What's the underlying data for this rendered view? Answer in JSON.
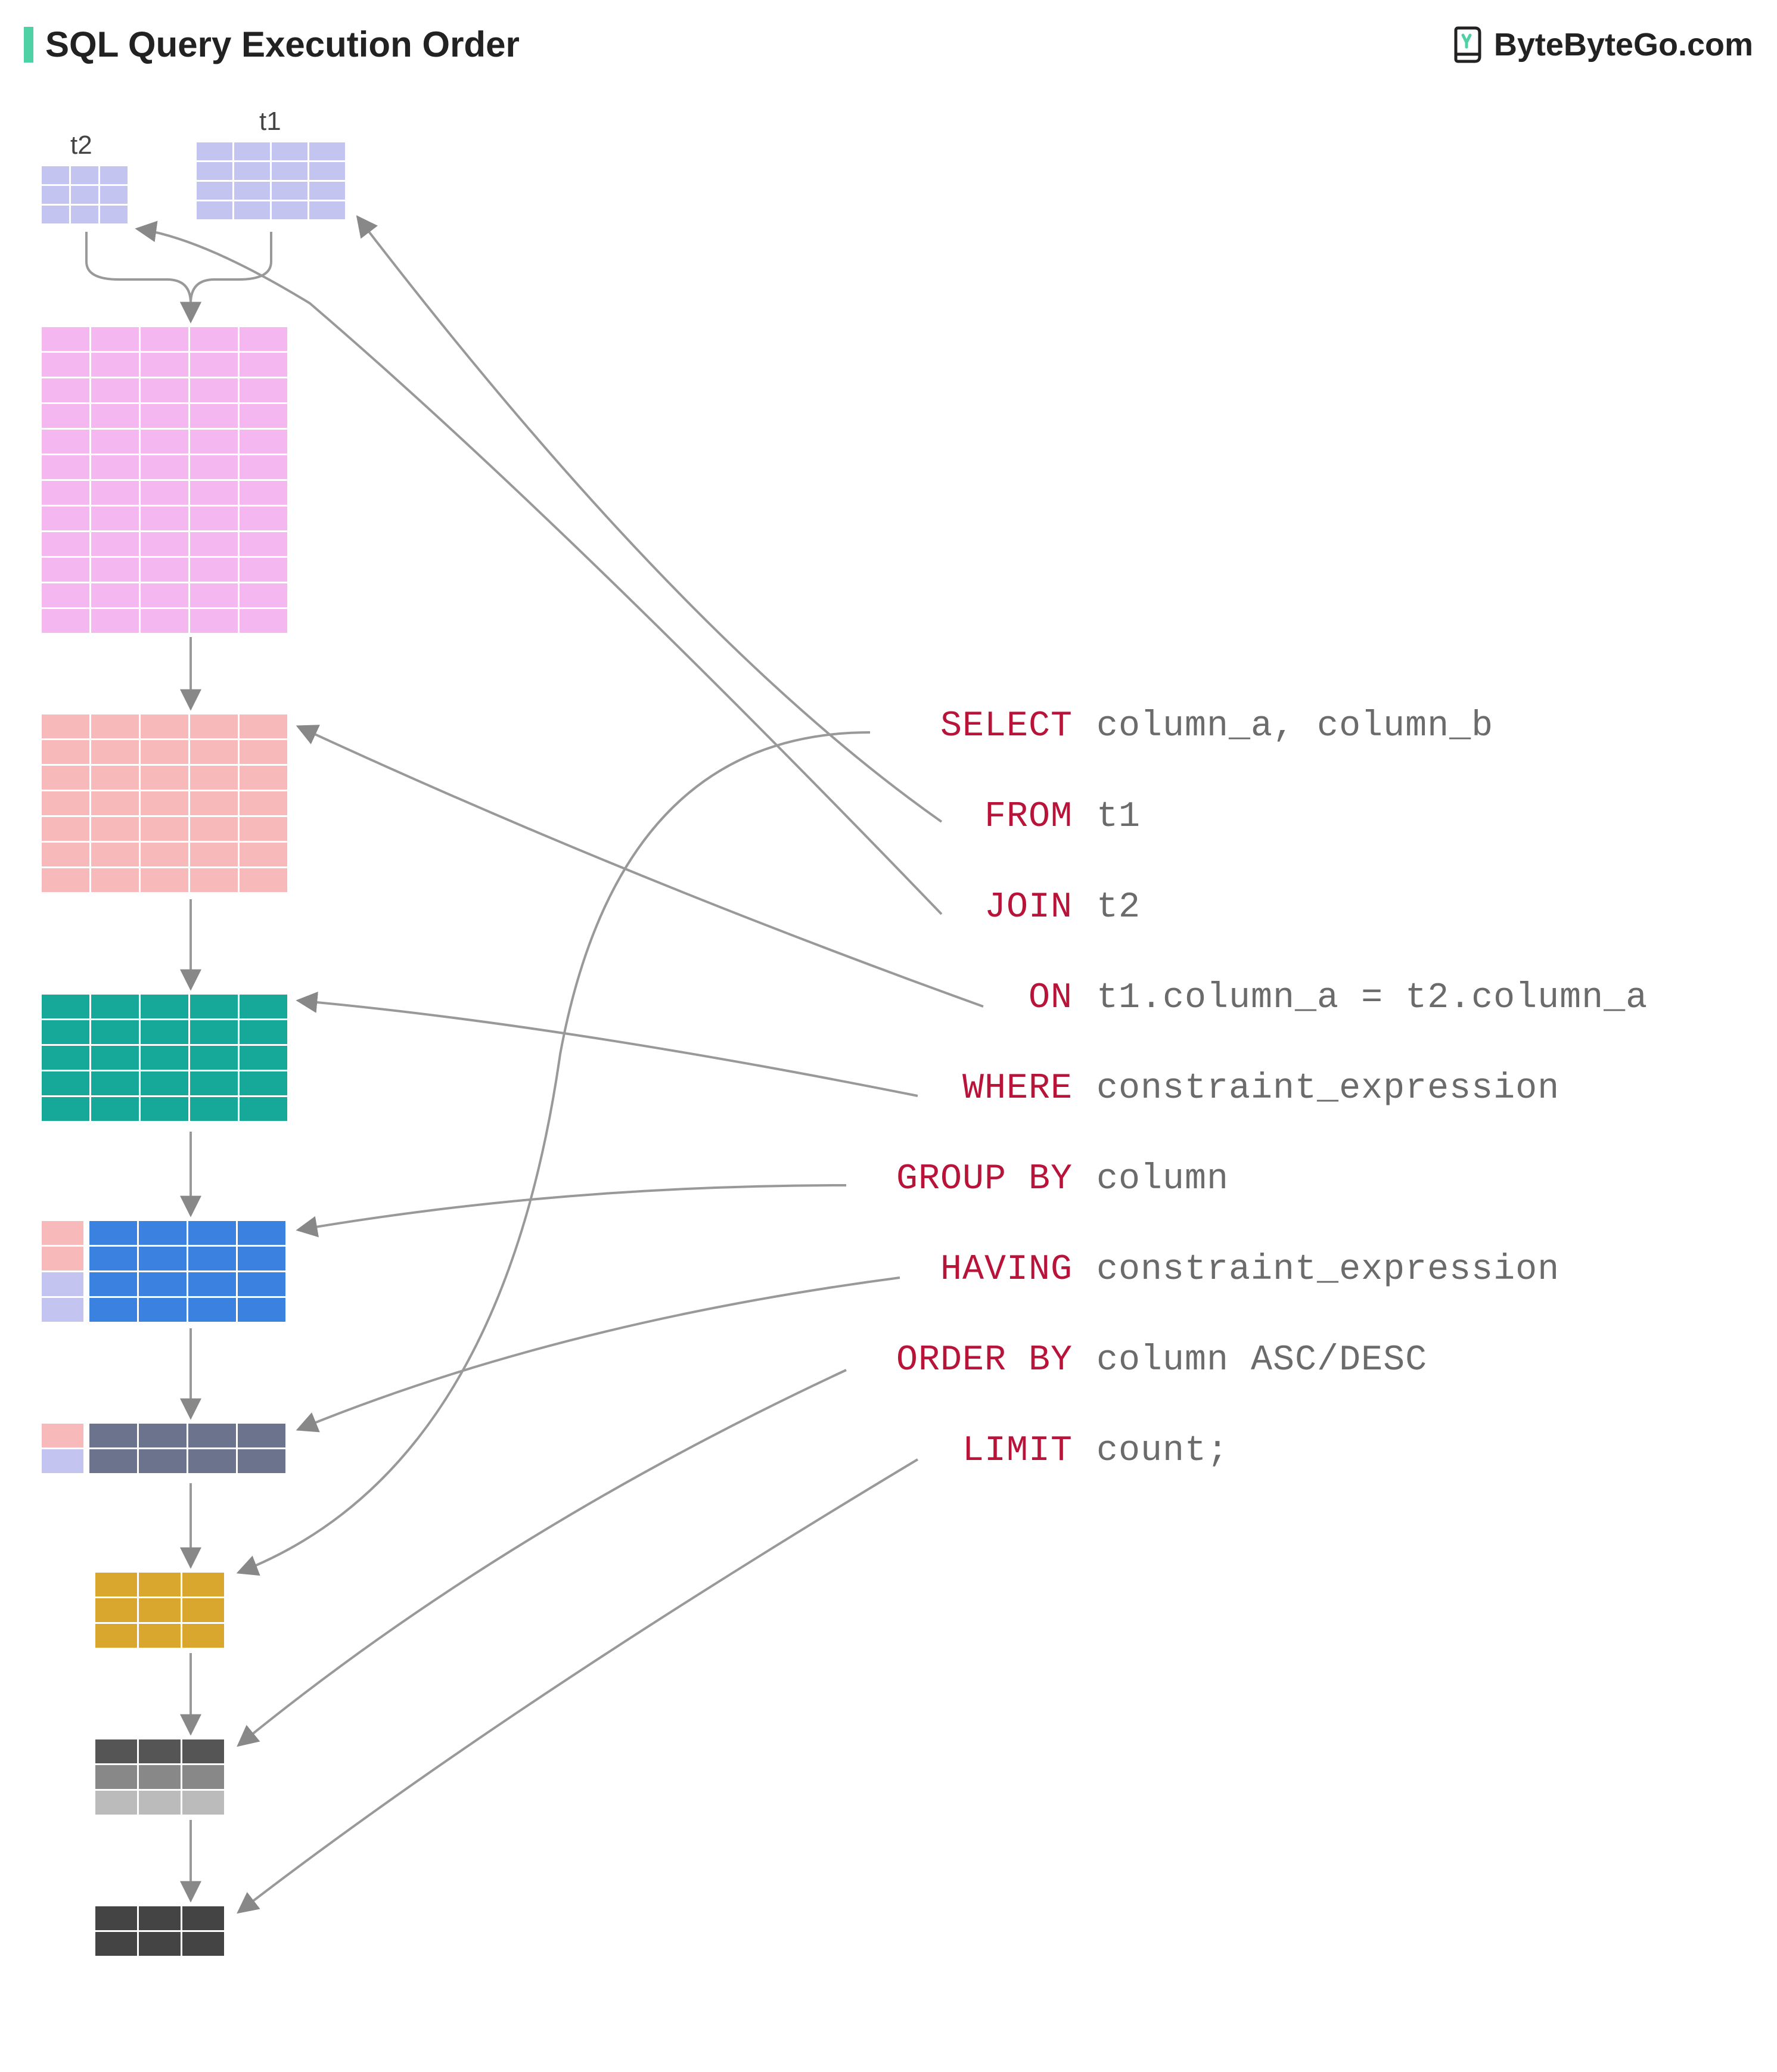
{
  "title": "SQL Query Execution Order",
  "brand": "ByteByteGo.com",
  "labels": {
    "t1": "t1",
    "t2": "t2"
  },
  "query": [
    {
      "kw": "SELECT",
      "arg": "column_a, column_b"
    },
    {
      "kw": "FROM",
      "arg": "t1"
    },
    {
      "kw": "JOIN",
      "arg": "t2"
    },
    {
      "kw": "ON",
      "arg": "t1.column_a = t2.column_a"
    },
    {
      "kw": "WHERE",
      "arg": "constraint_expression"
    },
    {
      "kw": "GROUP BY",
      "arg": "column"
    },
    {
      "kw": "HAVING",
      "arg": "constraint_expression"
    },
    {
      "kw": "ORDER BY",
      "arg": "column ASC/DESC"
    },
    {
      "kw": "LIMIT",
      "arg": "count;"
    }
  ],
  "colors": {
    "t_small": "#c3c5f0",
    "pink": "#f4b7f0",
    "salmon": "#f7b9b9",
    "teal": "#16a99a",
    "blue": "#3b82e0",
    "blue_light_a": "#f7b9b9",
    "blue_light_b": "#c3c5f0",
    "slate": "#6b748c",
    "gold": "#d9a62e",
    "gray1": "#555",
    "gray2": "#888",
    "gray3": "#bbb",
    "dark": "#444"
  }
}
